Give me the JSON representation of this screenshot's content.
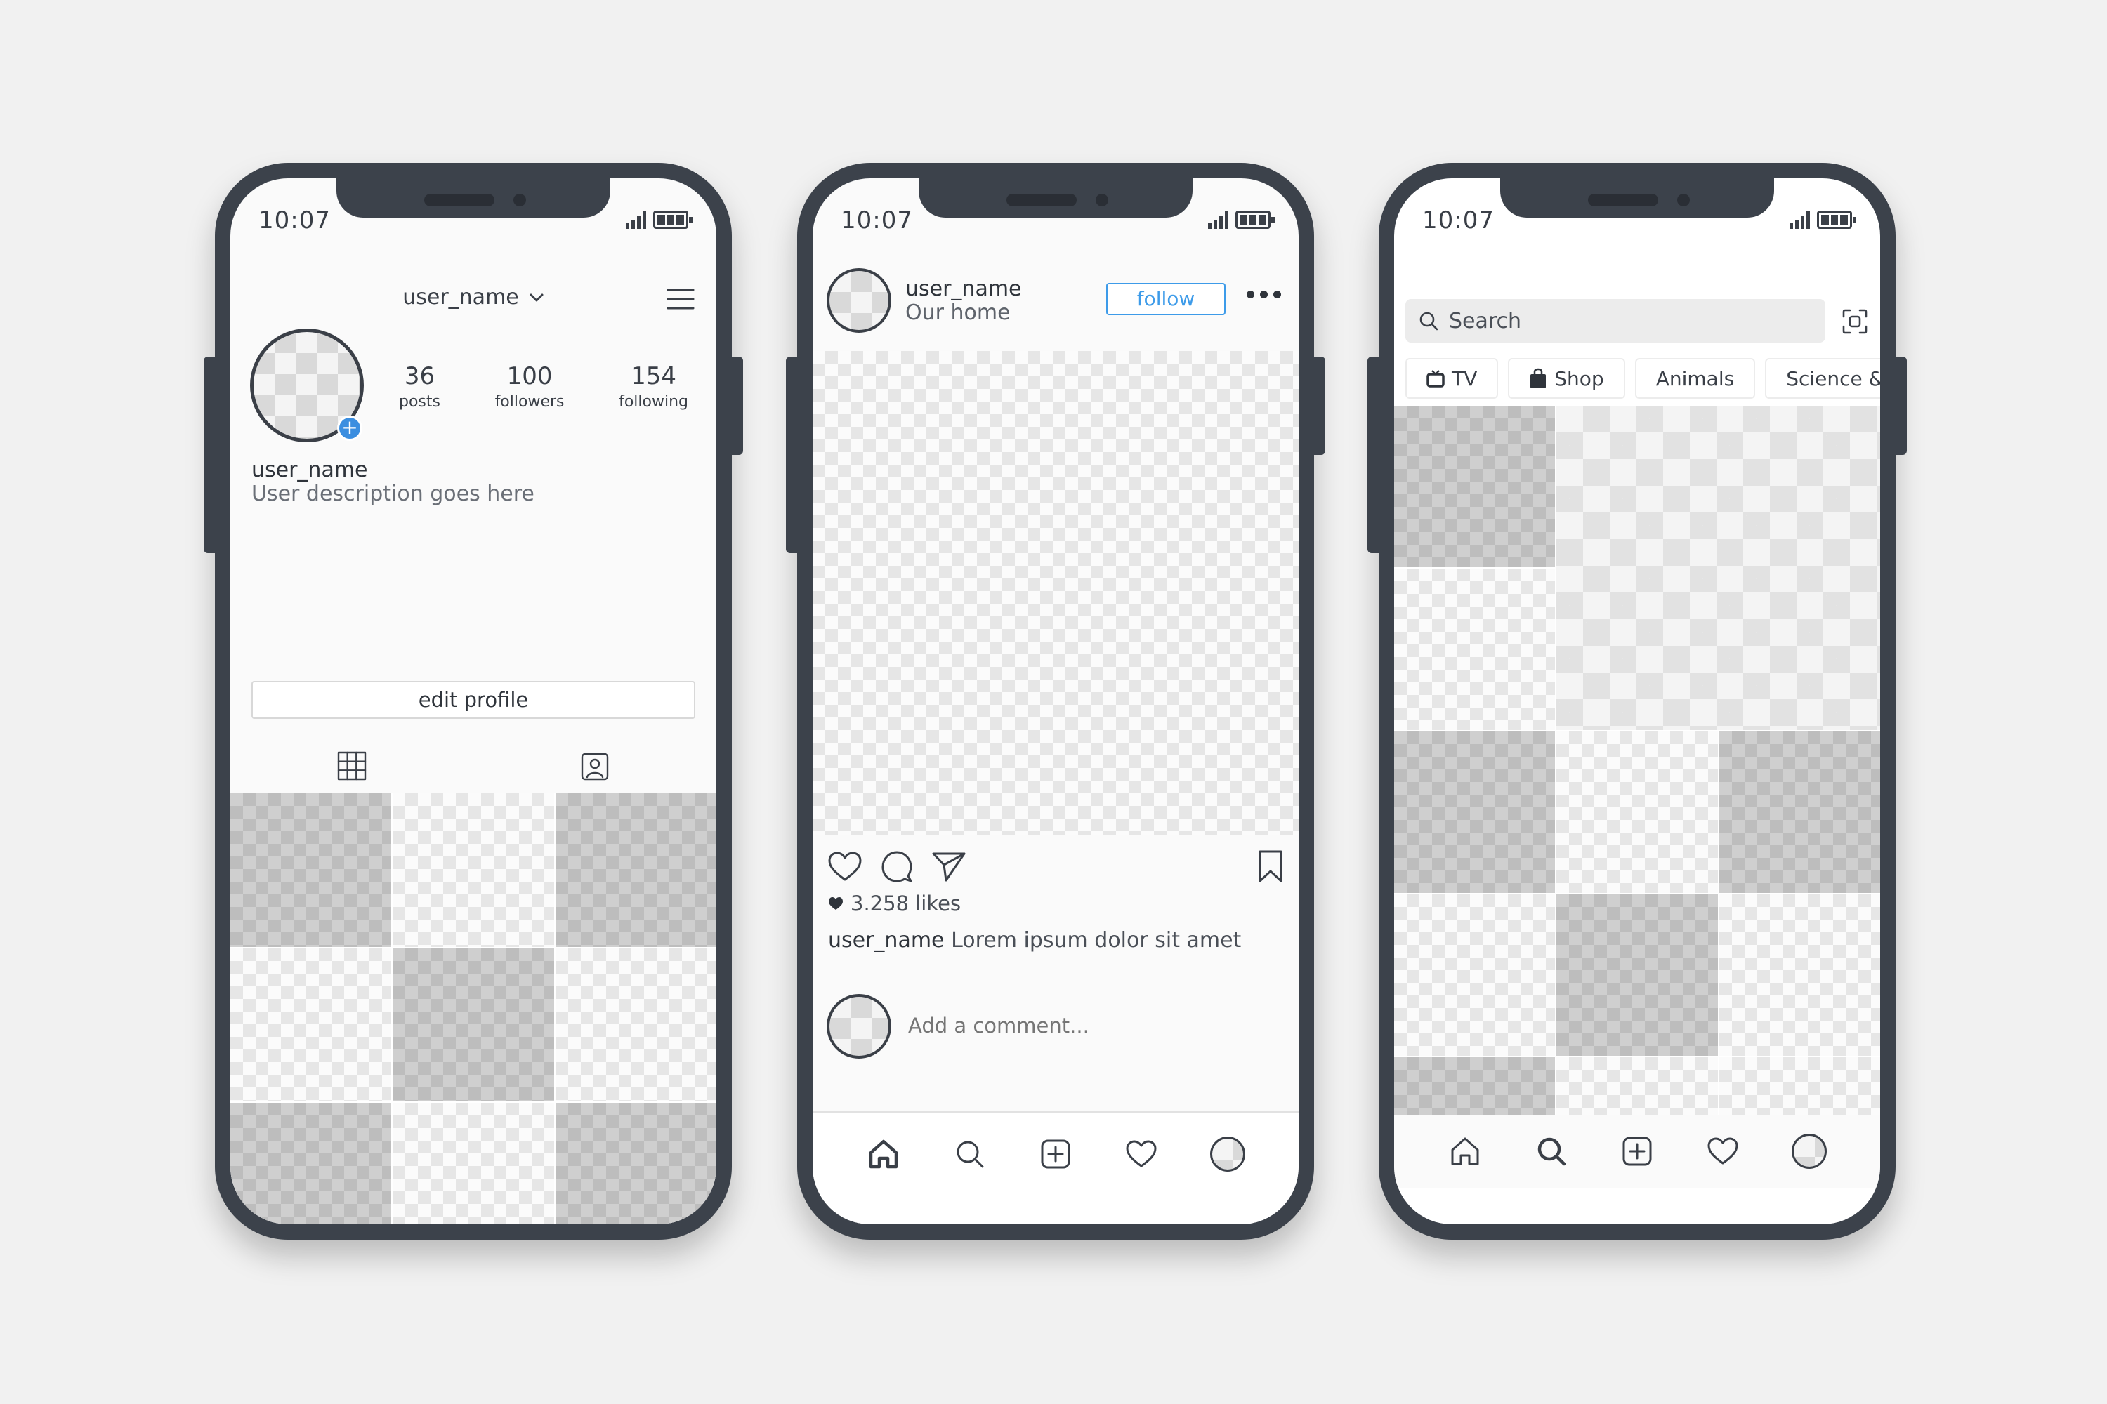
{
  "status_bar": {
    "time": "10:07"
  },
  "profile": {
    "header_username": "user_name",
    "stats": [
      {
        "value": "36",
        "label": "posts"
      },
      {
        "value": "100",
        "label": "followers"
      },
      {
        "value": "154",
        "label": "following"
      }
    ],
    "name": "user_name",
    "description": "User description goes here",
    "edit_button": "edit profile",
    "tabs": [
      "grid-icon",
      "tagged-icon"
    ]
  },
  "post": {
    "username": "user_name",
    "location": "Our home",
    "follow_button": "follow",
    "likes": "3.258 likes",
    "caption_user": "user_name",
    "caption_text": "Lorem ipsum dolor sit amet",
    "comment_placeholder": "Add a comment..."
  },
  "explore": {
    "search_placeholder": "Search",
    "chips": [
      {
        "label": "TV",
        "icon": "tv-icon"
      },
      {
        "label": "Shop",
        "icon": "shopping-bag-icon"
      },
      {
        "label": "Animals",
        "icon": ""
      },
      {
        "label": "Science & tec",
        "icon": ""
      }
    ]
  },
  "bottom_nav": [
    "home-icon",
    "search-icon",
    "add-post-icon",
    "activity-heart-icon",
    "profile-avatar"
  ],
  "colors": {
    "phone_frame": "#3c424b",
    "background": "#f1f1f1",
    "accent_blue": "#3d9be9",
    "add_badge": "#3b8ee0"
  }
}
